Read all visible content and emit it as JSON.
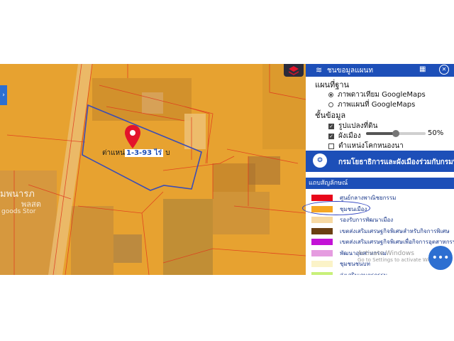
{
  "colors": {
    "map_tint": "#e7a230",
    "parcel_outline": "#3b4db5",
    "pin": "#e3142b",
    "panel_header": "#1d4fb8",
    "highlight_oval": "#2b3fc0"
  },
  "map": {
    "parcel_label_prefix": "ต่าแหน่",
    "parcel_area": "1-3-93",
    "parcel_area_unit": "ไร่",
    "parcel_label_suffix": "บ",
    "pin_icon": "map-pin-icon",
    "shop_sign_line1": "มพนารภ",
    "shop_sign_line2": "พลสต",
    "shop_sign_line3": "goods Stor"
  },
  "panel": {
    "header_title": "ชนขอมูลแผนท",
    "basemap_section": "แผนที่ฐาน",
    "basemap_options": [
      {
        "label": "ภาพดาวเทียม GoogleMaps",
        "selected": true
      },
      {
        "label": "ภาพแผนที่ GoogleMaps",
        "selected": false
      }
    ],
    "layers_section": "ชั้นข้อมูล",
    "layers": [
      {
        "label": "รูปแปลงที่ดิน",
        "checked": true
      },
      {
        "label": "ผังเมือง",
        "checked": true
      },
      {
        "label": "ตำแหน่งโคกหนองนา",
        "checked": false
      }
    ],
    "opacity_value": 0.5,
    "opacity_text": "50%",
    "dept_title": "กรมโยธาธิการและผังเมืองร่วมกับกรมที่ดิน",
    "legend_title": "แถบสัญลักษณ์",
    "legend": [
      {
        "label": "ศูนย์กลางพาณิชยกรรม",
        "color": "#e8071a"
      },
      {
        "label": "ชุมชนเมือง",
        "color": "#f5a623"
      },
      {
        "label": "รองรับการพัฒนาเมือง",
        "color": "#f7d9a3"
      },
      {
        "label": "เขตส่งเสริมเศรษฐกิจพิเศษสำหรับกิจการพิเศษ",
        "color": "#6b3f12"
      },
      {
        "label": "เขตส่งเสริมเศรษฐกิจพิเศษเพื่อกิจการอุตสาหกรรม",
        "color": "#c313d6"
      },
      {
        "label": "พัฒนาอุตสาหกรรม",
        "color": "#e59ce0"
      },
      {
        "label": "ชุมชนชนบท",
        "color": "#fbf3c8"
      },
      {
        "label": "ส่งเสริมเกษตรกรรม",
        "color": "#c8f07a"
      }
    ]
  },
  "watermark": {
    "line1": "Activate Windows",
    "line2": "Go to Settings to activate Windows."
  }
}
